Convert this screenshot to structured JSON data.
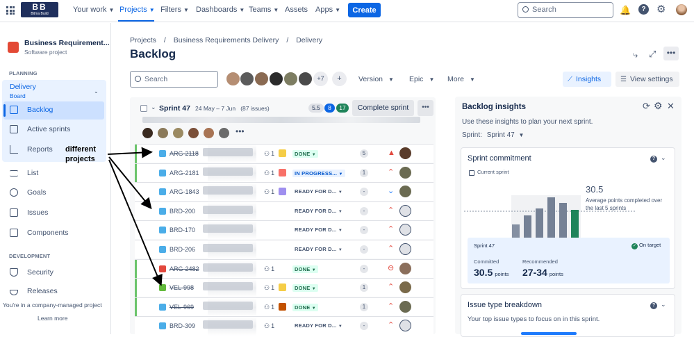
{
  "topnav": {
    "logo_top": "BB",
    "logo_bottom": "Bitma Build",
    "items": [
      {
        "label": "Your work",
        "caret": true
      },
      {
        "label": "Projects",
        "caret": true,
        "active": true
      },
      {
        "label": "Filters",
        "caret": true
      },
      {
        "label": "Dashboards",
        "caret": true
      },
      {
        "label": "Teams",
        "caret": true
      },
      {
        "label": "Assets",
        "caret": false
      },
      {
        "label": "Apps",
        "caret": true
      }
    ],
    "create_label": "Create",
    "search_placeholder": "Search"
  },
  "sidebar": {
    "project_name": "Business Requirement...",
    "project_type": "Software project",
    "planning_label": "PLANNING",
    "board_title": "Delivery",
    "board_sub": "Board",
    "planning_items": [
      {
        "label": "Backlog",
        "icon": "backlog-icon",
        "active": true
      },
      {
        "label": "Active sprints",
        "icon": "columns-icon"
      },
      {
        "label": "Reports",
        "icon": "chart-icon"
      }
    ],
    "other_items": [
      {
        "label": "List",
        "icon": "list-icon"
      },
      {
        "label": "Goals",
        "icon": "target-icon"
      },
      {
        "label": "Issues",
        "icon": "issues-icon"
      },
      {
        "label": "Components",
        "icon": "component-icon"
      }
    ],
    "development_label": "DEVELOPMENT",
    "dev_items": [
      {
        "label": "Security",
        "icon": "shield-icon"
      },
      {
        "label": "Releases",
        "icon": "ship-icon"
      }
    ],
    "footer_note": "You're in a company-managed project",
    "learn_more": "Learn more"
  },
  "breadcrumb": [
    "Projects",
    "Business Requirements Delivery",
    "Delivery"
  ],
  "page_title": "Backlog",
  "filters": {
    "search_placeholder": "Search",
    "avatar_more": "+7",
    "version": "Version",
    "epic": "Epic",
    "more": "More",
    "insights": "Insights",
    "view_settings": "View settings"
  },
  "sprint": {
    "name": "Sprint 47",
    "dates": "24 May – 7 Jun",
    "issue_count": "(87 issues)",
    "points_todo": "5.5",
    "points_inprogress": "8",
    "points_done": "17",
    "complete_label": "Complete sprint"
  },
  "issues": [
    {
      "key": "ARG-2118",
      "done": true,
      "sp": "1",
      "epic_color": "#f5cd47",
      "status": "DONE",
      "status_style": "green",
      "points": "5",
      "priority": "highest",
      "bar": "#6cc46c"
    },
    {
      "key": "ARG-2181",
      "done": false,
      "sp": "1",
      "epic_color": "#f87168",
      "status": "IN PROGRESS...",
      "status_style": "blue",
      "points": "1",
      "priority": "high",
      "bar": "#6cc46c"
    },
    {
      "key": "ARG-1843",
      "done": false,
      "sp": "1",
      "epic_color": "#9f8fef",
      "status": "READY FOR D...",
      "status_style": "plain",
      "points": "-",
      "priority": "lowest",
      "bar": ""
    },
    {
      "key": "BRD-200",
      "done": false,
      "sp": "",
      "epic_color": "",
      "status": "READY FOR D...",
      "status_style": "plain",
      "points": "-",
      "priority": "high",
      "bar": ""
    },
    {
      "key": "BRD-170",
      "done": false,
      "sp": "",
      "epic_color": "",
      "status": "READY FOR D...",
      "status_style": "plain",
      "points": "-",
      "priority": "high",
      "bar": ""
    },
    {
      "key": "BRD-206",
      "done": false,
      "sp": "",
      "epic_color": "",
      "status": "READY FOR D...",
      "status_style": "plain",
      "points": "-",
      "priority": "high",
      "bar": ""
    },
    {
      "key": "ARG-2482",
      "done": true,
      "sp": "1",
      "epic_color": "",
      "status": "DONE",
      "status_style": "green",
      "points": "-",
      "priority": "blocker",
      "bar": "#6cc46c"
    },
    {
      "key": "VEL-998",
      "done": true,
      "sp": "1",
      "epic_color": "#f5cd47",
      "status": "DONE",
      "status_style": "green",
      "points": "1",
      "priority": "high",
      "bar": "#6cc46c"
    },
    {
      "key": "VEL-969",
      "done": true,
      "sp": "1",
      "epic_color": "#c25100",
      "status": "DONE",
      "status_style": "green",
      "points": "1",
      "priority": "high",
      "bar": "#6cc46c"
    },
    {
      "key": "BRD-309",
      "done": false,
      "sp": "1",
      "epic_color": "",
      "status": "READY FOR D...",
      "status_style": "plain",
      "points": "-",
      "priority": "high",
      "bar": ""
    }
  ],
  "annotation": "different\nprojects",
  "insights": {
    "title": "Backlog insights",
    "subtitle": "Use these insights to plan your next sprint.",
    "sprint_label": "Sprint:",
    "sprint_value": "Sprint 47",
    "commitment_title": "Sprint commitment",
    "current_sprint": "Current sprint",
    "average_value": "30.5",
    "average_text": "Average points completed over the last 5 sprints",
    "sprint_name": "Sprint 47",
    "on_target": "On target",
    "committed_label": "Committed",
    "committed_value": "30.5",
    "committed_unit": "points",
    "recommended_label": "Recommended",
    "recommended_value": "27-34",
    "recommended_unit": "points",
    "breakdown_title": "Issue type breakdown",
    "breakdown_sub": "Your top issue types to focus on in this sprint."
  },
  "colors": {
    "accent": "#0c66e4",
    "done_bar": "#6cc46c"
  }
}
